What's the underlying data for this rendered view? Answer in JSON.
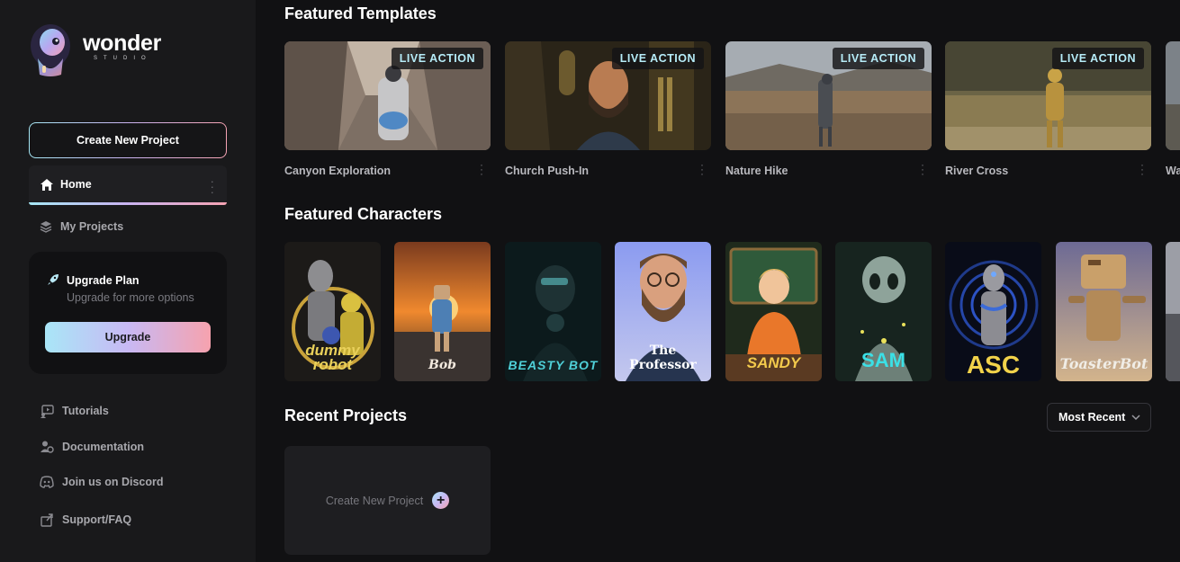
{
  "brand": {
    "name": "wonder",
    "sub": "STUDIO"
  },
  "sidebar": {
    "create_label": "Create New Project",
    "nav": [
      {
        "label": "Home",
        "icon": "home-icon",
        "active": true
      },
      {
        "label": "My Projects",
        "icon": "layers-icon"
      }
    ],
    "upgrade": {
      "title": "Upgrade Plan",
      "subtitle": "Upgrade for more options",
      "button": "Upgrade",
      "icon": "rocket-icon"
    },
    "links": [
      {
        "label": "Tutorials",
        "icon": "tutorials-icon"
      },
      {
        "label": "Documentation",
        "icon": "documentation-icon"
      },
      {
        "label": "Join us on Discord",
        "icon": "discord-icon"
      },
      {
        "label": "Support/FAQ",
        "icon": "support-icon"
      }
    ]
  },
  "templates": {
    "title": "Featured Templates",
    "badge": "LIVE ACTION",
    "items": [
      {
        "label": "Canyon Exploration"
      },
      {
        "label": "Church Push-In"
      },
      {
        "label": "Nature Hike"
      },
      {
        "label": "River Cross"
      },
      {
        "label": "Wa"
      }
    ]
  },
  "characters": {
    "title": "Featured Characters",
    "items": [
      {
        "name": "dummy robot"
      },
      {
        "name": "Bob"
      },
      {
        "name": "BEASTY BOT"
      },
      {
        "name": "The Professor"
      },
      {
        "name": "SANDY"
      },
      {
        "name": "SAM"
      },
      {
        "name": "ASC"
      },
      {
        "name": "ToasterBot"
      }
    ]
  },
  "recent": {
    "title": "Recent Projects",
    "sort_label": "Most Recent",
    "new_label": "Create New Project"
  },
  "colors": {
    "accent_start": "#a9e6f7",
    "accent_mid": "#c8b9f4",
    "accent_end": "#f6a2ae",
    "badge_text": "#b6ecf8"
  }
}
